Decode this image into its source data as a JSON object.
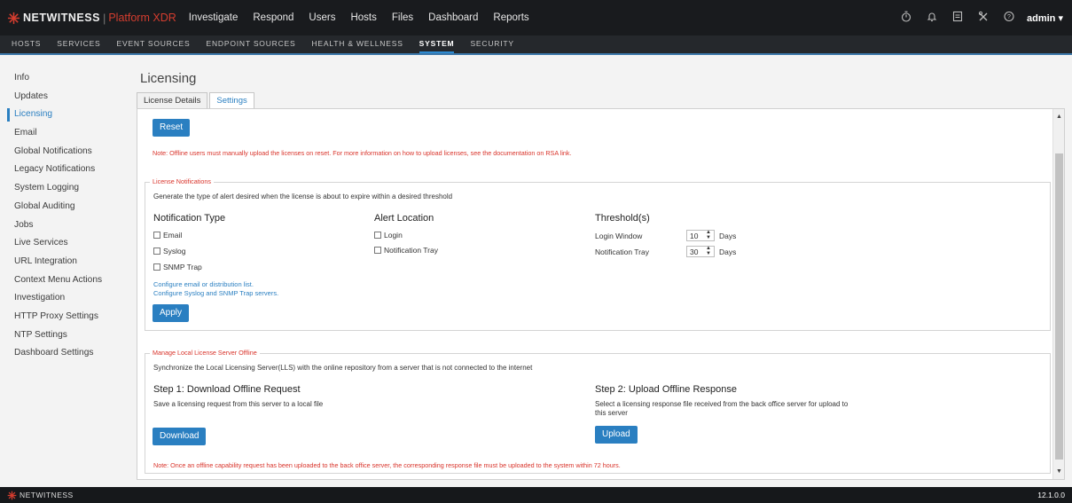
{
  "colors": {
    "accent": "#2a7fc1",
    "brand_red": "#d43d2f",
    "note_red": "#d9342b",
    "topbar": "#191b1e",
    "subnav": "#25282c"
  },
  "brand": {
    "name": "NETWITNESS",
    "separator": "|",
    "product": "Platform XDR"
  },
  "main_nav": [
    "Investigate",
    "Respond",
    "Users",
    "Hosts",
    "Files",
    "Dashboard",
    "Reports"
  ],
  "top_icons": [
    "timer-icon",
    "bell-icon",
    "notes-icon",
    "tools-icon",
    "help-icon"
  ],
  "user": {
    "name": "admin",
    "caret": "▾"
  },
  "sub_nav": {
    "items": [
      "HOSTS",
      "SERVICES",
      "EVENT SOURCES",
      "ENDPOINT SOURCES",
      "HEALTH & WELLNESS",
      "SYSTEM",
      "SECURITY"
    ],
    "active": "SYSTEM"
  },
  "sidebar": {
    "items": [
      "Info",
      "Updates",
      "Licensing",
      "Email",
      "Global Notifications",
      "Legacy Notifications",
      "System Logging",
      "Global Auditing",
      "Jobs",
      "Live Services",
      "URL Integration",
      "Context Menu Actions",
      "Investigation",
      "HTTP Proxy Settings",
      "NTP Settings",
      "Dashboard Settings"
    ],
    "active": "Licensing"
  },
  "page": {
    "title": "Licensing"
  },
  "tabs": {
    "items": [
      "License Details",
      "Settings"
    ],
    "active": "Settings"
  },
  "reset_section": {
    "button": "Reset",
    "note": "Note: Offline users must manually upload the licenses on reset. For more information on how to upload licenses, see the documentation on RSA link."
  },
  "license_notifications": {
    "legend": "License Notifications",
    "description": "Generate the type of alert desired when the license is about to expire within a desired threshold",
    "notification_type": {
      "heading": "Notification Type",
      "options": [
        "Email",
        "Syslog",
        "SNMP Trap"
      ]
    },
    "alert_location": {
      "heading": "Alert Location",
      "options": [
        "Login",
        "Notification Tray"
      ]
    },
    "thresholds": {
      "heading": "Threshold(s)",
      "rows": [
        {
          "label": "Login Window",
          "value": "10",
          "unit": "Days"
        },
        {
          "label": "Notification Tray",
          "value": "30",
          "unit": "Days"
        }
      ]
    },
    "links": [
      "Configure email or distribution list.",
      "Configure Syslog and SNMP Trap servers."
    ],
    "apply_button": "Apply"
  },
  "offline_section": {
    "legend": "Manage Local License Server Offline",
    "description": "Synchronize the Local Licensing Server(LLS) with the online repository from a server that is not connected to the internet",
    "step1": {
      "title": "Step 1: Download Offline Request",
      "description": "Save a licensing request from this server to a local file",
      "button": "Download"
    },
    "step2": {
      "title": "Step 2: Upload Offline Response",
      "description_line1": "Select a licensing response file received from the back office server for upload to",
      "description_line2": "this server",
      "button": "Upload"
    },
    "note": "Note: Once an offline capability request has been uploaded to the back office server, the corresponding response file must be uploaded to the system within 72 hours."
  },
  "footer": {
    "brand": "NETWITNESS",
    "version": "12.1.0.0"
  }
}
